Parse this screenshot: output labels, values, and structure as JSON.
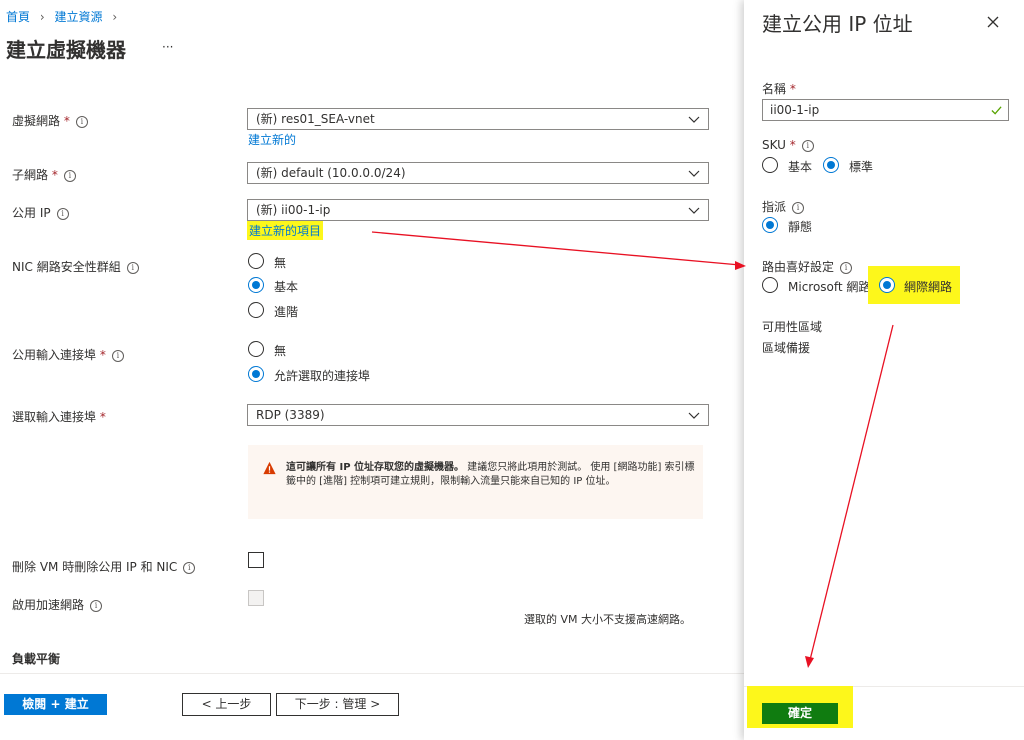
{
  "breadcrumb": {
    "home": "首頁",
    "create_resource": "建立資源"
  },
  "page_title": "建立虛擬機器",
  "more": "···",
  "form": {
    "vnet": {
      "label": "虛擬網路",
      "value": "(新) res01_SEA-vnet",
      "create_link": "建立新的"
    },
    "subnet": {
      "label": "子網路",
      "value": "(新) default (10.0.0.0/24)"
    },
    "public_ip": {
      "label": "公用 IP",
      "value": "(新) ii00-1-ip",
      "create_link": "建立新的項目"
    },
    "nsg": {
      "label": "NIC 網路安全性群組",
      "options": [
        "無",
        "基本",
        "進階"
      ],
      "selected": "基本"
    },
    "public_inbound": {
      "label": "公用輸入連接埠",
      "options": [
        "無",
        "允許選取的連接埠"
      ],
      "selected": "允許選取的連接埠"
    },
    "inbound_ports": {
      "label": "選取輸入連接埠",
      "value": "RDP (3389)"
    },
    "warning": {
      "bold": "這可讓所有 IP 位址存取您的虛擬機器。",
      "text": " 建議您只將此項用於測試。 使用 [網路功能] 索引標籤中的 [進階] 控制項可建立規則，限制輸入流量只能來自已知的 IP 位址。"
    },
    "delete_with_vm": {
      "label": "刪除 VM 時刪除公用 IP 和 NIC"
    },
    "accel_net": {
      "label": "啟用加速網路",
      "note": "選取的 VM 大小不支援高速網路。"
    },
    "load_balance": "負載平衡"
  },
  "footer": {
    "review_create": "檢閱 + 建立",
    "prev": "< 上一步",
    "next": "下一步 : 管理 >"
  },
  "panel": {
    "title": "建立公用 IP 位址",
    "name": {
      "label": "名稱",
      "value": "ii00-1-ip"
    },
    "sku": {
      "label": "SKU",
      "options": [
        "基本",
        "標準"
      ],
      "selected": "標準"
    },
    "assignment": {
      "label": "指派",
      "options": [
        "靜態"
      ],
      "selected": "靜態"
    },
    "routing": {
      "label": "路由喜好設定",
      "options": [
        "Microsoft 網路",
        "網際網路"
      ],
      "selected": "網際網路"
    },
    "availability": {
      "label": "可用性區域",
      "value": "區域備援"
    },
    "ok": "確定"
  },
  "colors": {
    "accent": "#0078d4",
    "ok_button": "#107c10",
    "highlight": "#fdf71b",
    "arrow": "#e81123",
    "warning_bg": "#fdf6f1"
  }
}
